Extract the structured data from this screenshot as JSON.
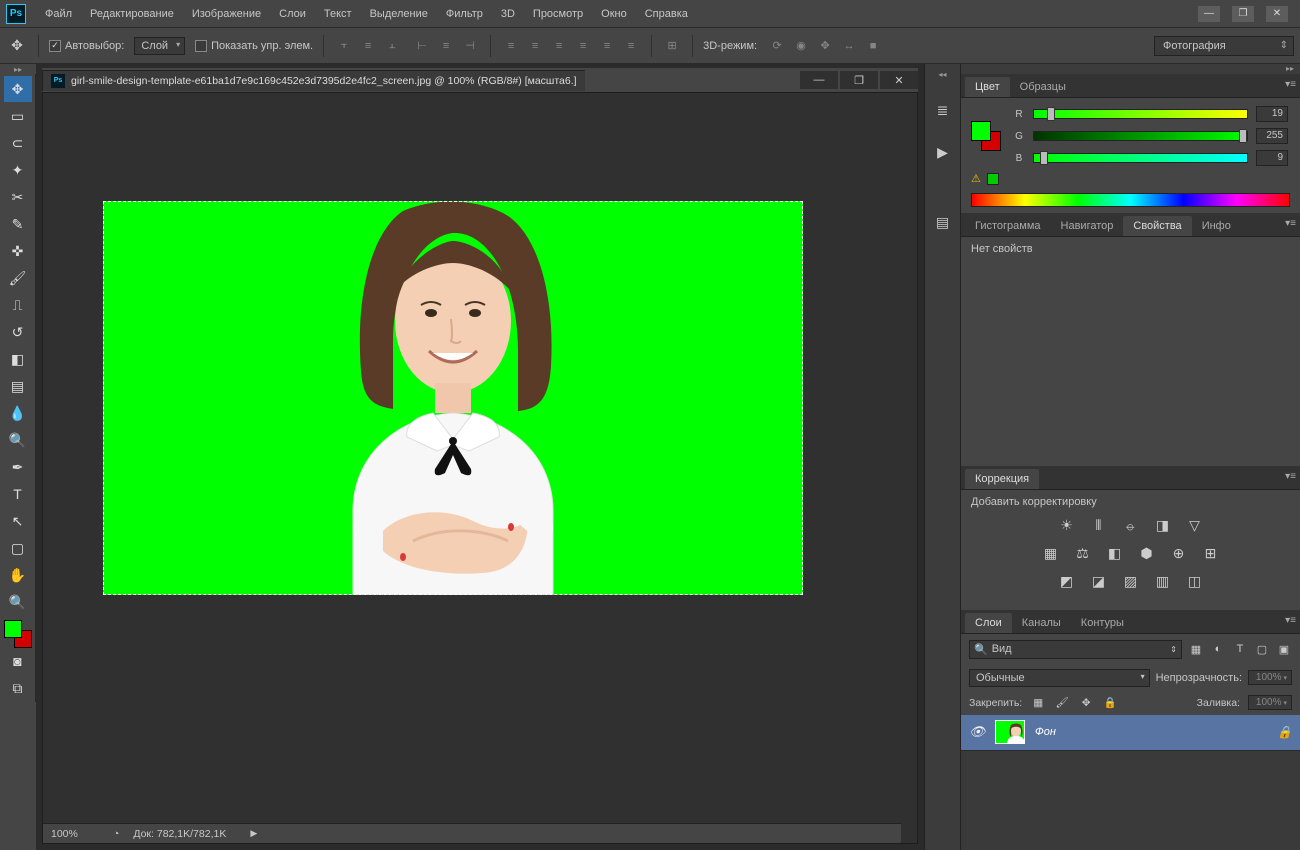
{
  "menubar": {
    "items": [
      "Файл",
      "Редактирование",
      "Изображение",
      "Слои",
      "Текст",
      "Выделение",
      "Фильтр",
      "3D",
      "Просмотр",
      "Окно",
      "Справка"
    ]
  },
  "optionsbar": {
    "autoSelect": "Автовыбор:",
    "autoSelectTarget": "Слой",
    "showTransform": "Показать упр. элем.",
    "threeDMode": "3D-режим:",
    "workspace": "Фотография"
  },
  "document": {
    "title": "girl-smile-design-template-e61ba1d7e9c169c452e3d7395d2e4fc2_screen.jpg @ 100% (RGB/8#) [масшта6.]"
  },
  "status": {
    "zoom": "100%",
    "docLabel": "Док:",
    "docSize": "782,1K/782,1K"
  },
  "colorPanel": {
    "tabs": [
      "Цвет",
      "Образцы"
    ],
    "labels": {
      "r": "R",
      "g": "G",
      "b": "B"
    },
    "values": {
      "r": "19",
      "g": "255",
      "b": "9"
    }
  },
  "propsPanel": {
    "tabs": [
      "Гистограмма",
      "Навигатор",
      "Свойства",
      "Инфо"
    ],
    "empty": "Нет свойств"
  },
  "corrections": {
    "tab": "Коррекция",
    "subtitle": "Добавить корректировку"
  },
  "layersPanel": {
    "tabs": [
      "Слои",
      "Каналы",
      "Контуры"
    ],
    "filterKind": "Вид",
    "blendMode": "Обычные",
    "opacityLabel": "Непрозрачность:",
    "opacity": "100%",
    "lockLabel": "Закрепить:",
    "fillLabel": "Заливка:",
    "fill": "100%",
    "layerName": "Фон"
  }
}
